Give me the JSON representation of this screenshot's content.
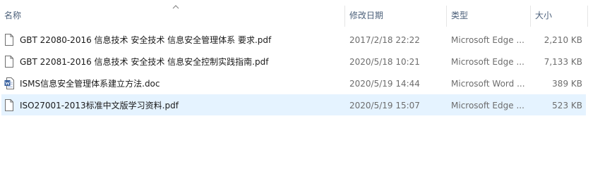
{
  "columns": {
    "name": "名称",
    "modified": "修改日期",
    "type": "类型",
    "size": "大小"
  },
  "files": [
    {
      "name": "GBT 22080-2016 信息技术 安全技术 信息安全管理体系 要求.pdf",
      "modified": "2017/2/18 22:22",
      "type": "Microsoft Edge ...",
      "size": "2,210 KB",
      "icon": "pdf-file-icon"
    },
    {
      "name": "GBT 22081-2016 信息技术 安全技术 信息安全控制实践指南.pdf",
      "modified": "2020/5/18 10:21",
      "type": "Microsoft Edge ...",
      "size": "7,133 KB",
      "icon": "pdf-file-icon"
    },
    {
      "name": "ISMS信息安全管理体系建立方法.doc",
      "modified": "2020/5/19 14:44",
      "type": "Microsoft Word ...",
      "size": "389 KB",
      "icon": "word-file-icon"
    },
    {
      "name": "ISO27001-2013标准中文版学习资料.pdf",
      "modified": "2020/5/19 15:07",
      "type": "Microsoft Edge ...",
      "size": "523 KB",
      "icon": "pdf-file-icon"
    }
  ],
  "colors": {
    "header_text": "#4c607a",
    "selection": "#e5f3ff",
    "word_icon": "#2b579a"
  }
}
